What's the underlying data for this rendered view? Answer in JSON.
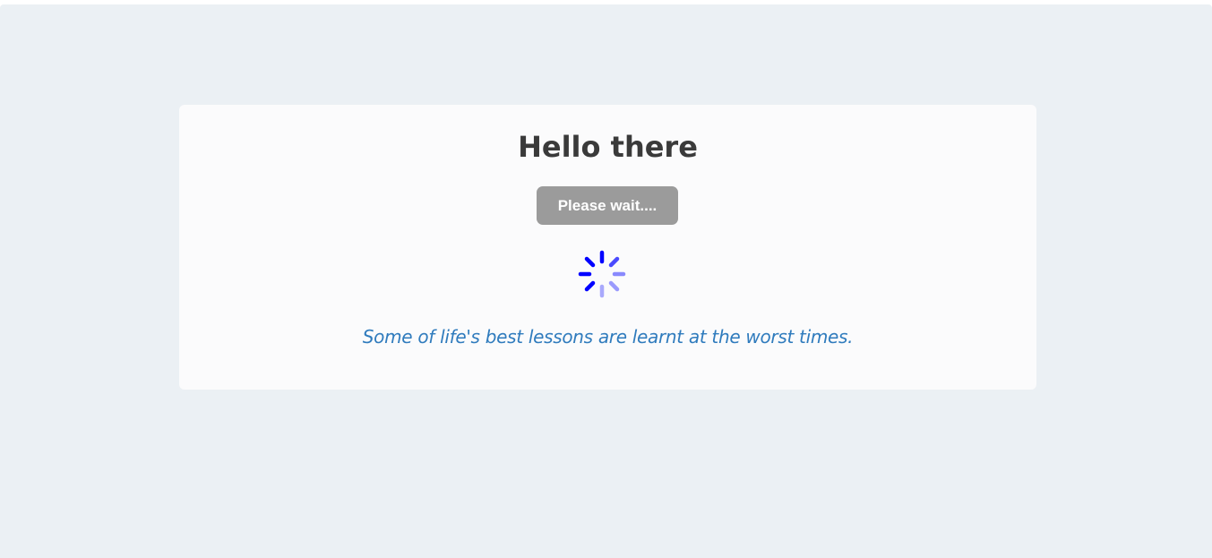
{
  "card": {
    "title": "Hello there",
    "button_label": "Please wait....",
    "spinner_icon": "loading-spinner-icon",
    "quote": "Some of life's best lessons are learnt at the worst times."
  },
  "colors": {
    "page_background": "#ebf0f4",
    "card_background": "#fbfbfc",
    "title": "#3a3a3a",
    "button_background": "#9b9b9b",
    "button_text": "#ffffff",
    "spinner": "#0000ff",
    "quote": "#2f7bbd"
  }
}
